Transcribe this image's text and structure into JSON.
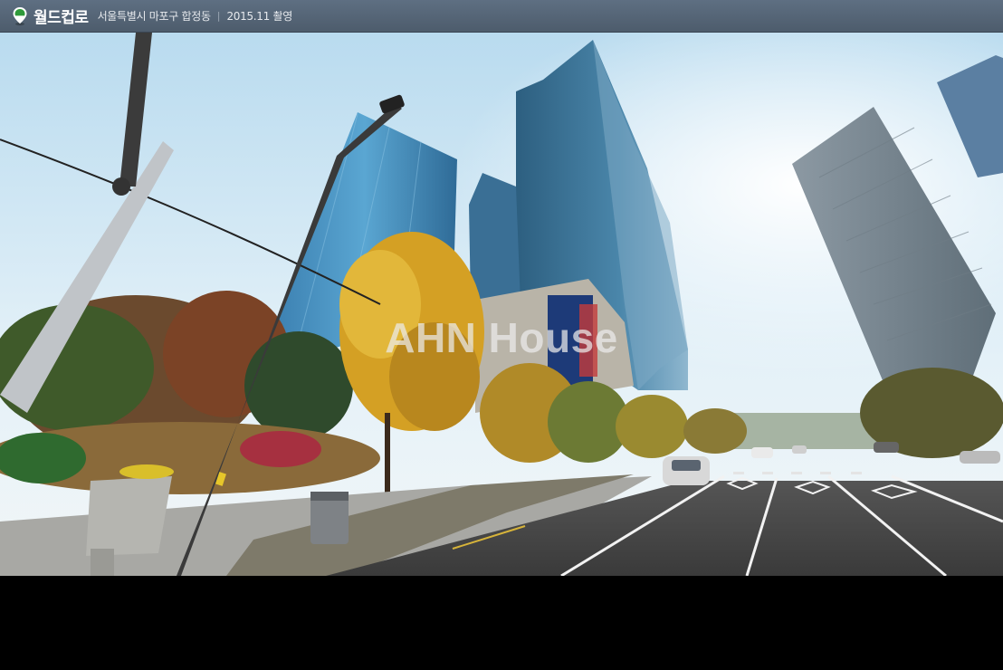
{
  "header": {
    "brand": "월드컵로",
    "location": "서울특별시 마포구 합정동",
    "separator": "|",
    "date": "2015.11 촬영",
    "pin_icon": "map-pin-icon",
    "brand_color": "#5e6f82"
  },
  "viewer": {
    "watermark": "AHN House",
    "scene": "street-view-panorama"
  }
}
